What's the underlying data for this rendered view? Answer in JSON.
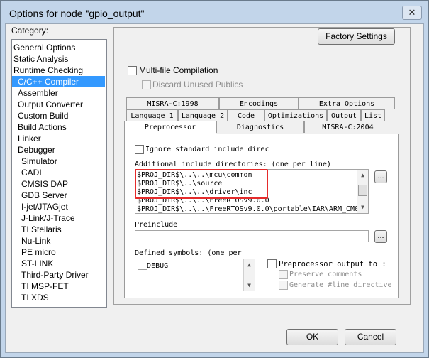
{
  "window": {
    "title": "Options for node \"gpio_output\"",
    "close_glyph": "✕"
  },
  "category": {
    "label": "Category:",
    "items": [
      {
        "label": "General Options",
        "indent": 0
      },
      {
        "label": "Static Analysis",
        "indent": 0
      },
      {
        "label": "Runtime Checking",
        "indent": 0
      },
      {
        "label": "C/C++ Compiler",
        "indent": 1,
        "selected": true
      },
      {
        "label": "Assembler",
        "indent": 1
      },
      {
        "label": "Output Converter",
        "indent": 1
      },
      {
        "label": "Custom Build",
        "indent": 1
      },
      {
        "label": "Build Actions",
        "indent": 1
      },
      {
        "label": "Linker",
        "indent": 1
      },
      {
        "label": "Debugger",
        "indent": 1
      },
      {
        "label": "Simulator",
        "indent": 2
      },
      {
        "label": "CADI",
        "indent": 2
      },
      {
        "label": "CMSIS DAP",
        "indent": 2
      },
      {
        "label": "GDB Server",
        "indent": 2
      },
      {
        "label": "I-jet/JTAGjet",
        "indent": 2
      },
      {
        "label": "J-Link/J-Trace",
        "indent": 2
      },
      {
        "label": "TI Stellaris",
        "indent": 2
      },
      {
        "label": "Nu-Link",
        "indent": 2
      },
      {
        "label": "PE micro",
        "indent": 2
      },
      {
        "label": "ST-LINK",
        "indent": 2
      },
      {
        "label": "Third-Party Driver",
        "indent": 2
      },
      {
        "label": "TI MSP-FET",
        "indent": 2
      },
      {
        "label": "TI XDS",
        "indent": 2
      }
    ]
  },
  "top_options": {
    "factory_settings": "Factory Settings",
    "multi_file": "Multi-file Compilation",
    "discard_unused": "Discard Unused Publics"
  },
  "tabs": {
    "row1": [
      "MISRA-C:1998",
      "Encodings",
      "Extra Options"
    ],
    "row2": [
      "Language 1",
      "Language 2",
      "Code",
      "Optimizations",
      "Output",
      "List"
    ],
    "row3": [
      "Preprocessor",
      "Diagnostics",
      "MISRA-C:2004"
    ]
  },
  "preprocessor": {
    "ignore_std": "Ignore standard include direc",
    "include_label": "Additional include directories: (one per line)",
    "include_lines": [
      "$PROJ_DIR$\\..\\..\\mcu\\common",
      "$PROJ_DIR$\\..\\source",
      "$PROJ_DIR$\\..\\..\\driver\\inc",
      "$PROJ_DIR$\\..\\..\\FreeRTOSv9.0.0",
      "$PROJ_DIR$\\..\\..\\FreeRTOSv9.0.0\\portable\\IAR\\ARM_CM0"
    ],
    "browse": "...",
    "preinclude_label": "Preinclude",
    "preinclude_value": "",
    "defined_label": "Defined symbols: (one per",
    "defined_lines": [
      "__DEBUG"
    ],
    "pp_output": "Preprocessor output to :",
    "preserve_comments": "Preserve comments",
    "gen_line": "Generate #line directive"
  },
  "buttons": {
    "ok": "OK",
    "cancel": "Cancel"
  },
  "colors": {
    "selection": "#3399ff",
    "highlight": "#e52b2b"
  }
}
